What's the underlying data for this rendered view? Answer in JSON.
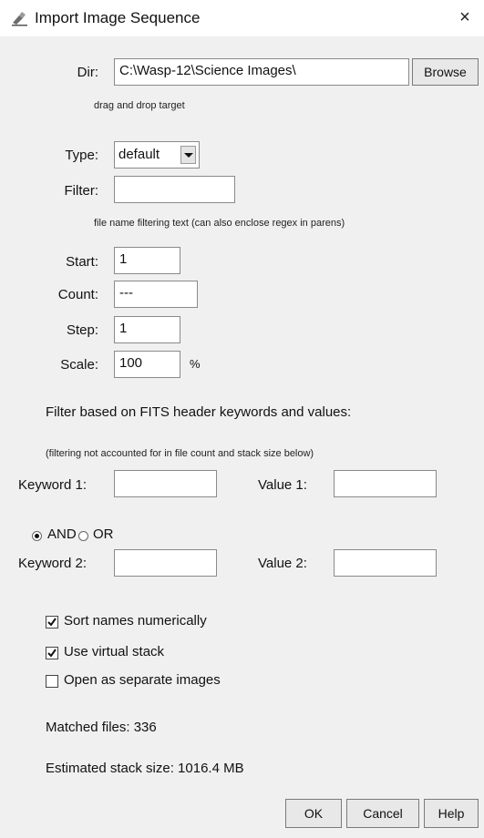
{
  "window": {
    "title": "Import Image Sequence",
    "close_glyph": "×"
  },
  "dir": {
    "label": "Dir:",
    "value": "C:\\Wasp-12\\Science Images\\",
    "browse_label": "Browse",
    "hint": "drag and drop target"
  },
  "type": {
    "label": "Type:",
    "value": "default"
  },
  "filter": {
    "label": "Filter:",
    "value": "",
    "hint": "file name filtering text (can also enclose regex in parens)"
  },
  "start": {
    "label": "Start:",
    "value": "1"
  },
  "count": {
    "label": "Count:",
    "value": "---"
  },
  "step": {
    "label": "Step:",
    "value": "1"
  },
  "scale": {
    "label": "Scale:",
    "value": "100",
    "unit": "%"
  },
  "fits": {
    "heading": "Filter based on FITS header keywords and values:",
    "note": "(filtering not accounted for in file count and stack size below)",
    "keyword1_label": "Keyword 1:",
    "keyword1_value": "",
    "value1_label": "Value 1:",
    "value1_value": "",
    "and_label": "AND",
    "or_label": "OR",
    "selected": "AND",
    "keyword2_label": "Keyword 2:",
    "keyword2_value": "",
    "value2_label": "Value 2:",
    "value2_value": ""
  },
  "options": {
    "sort_label": "Sort names numerically",
    "sort_checked": true,
    "virtual_label": "Use virtual stack",
    "virtual_checked": true,
    "separate_label": "Open as separate images",
    "separate_checked": false
  },
  "stats": {
    "matched": "Matched files: 336",
    "size": "Estimated stack size: 1016.4 MB"
  },
  "buttons": {
    "ok": "OK",
    "cancel": "Cancel",
    "help": "Help"
  },
  "icons": {
    "app": "microscope-icon",
    "close": "close-icon"
  }
}
